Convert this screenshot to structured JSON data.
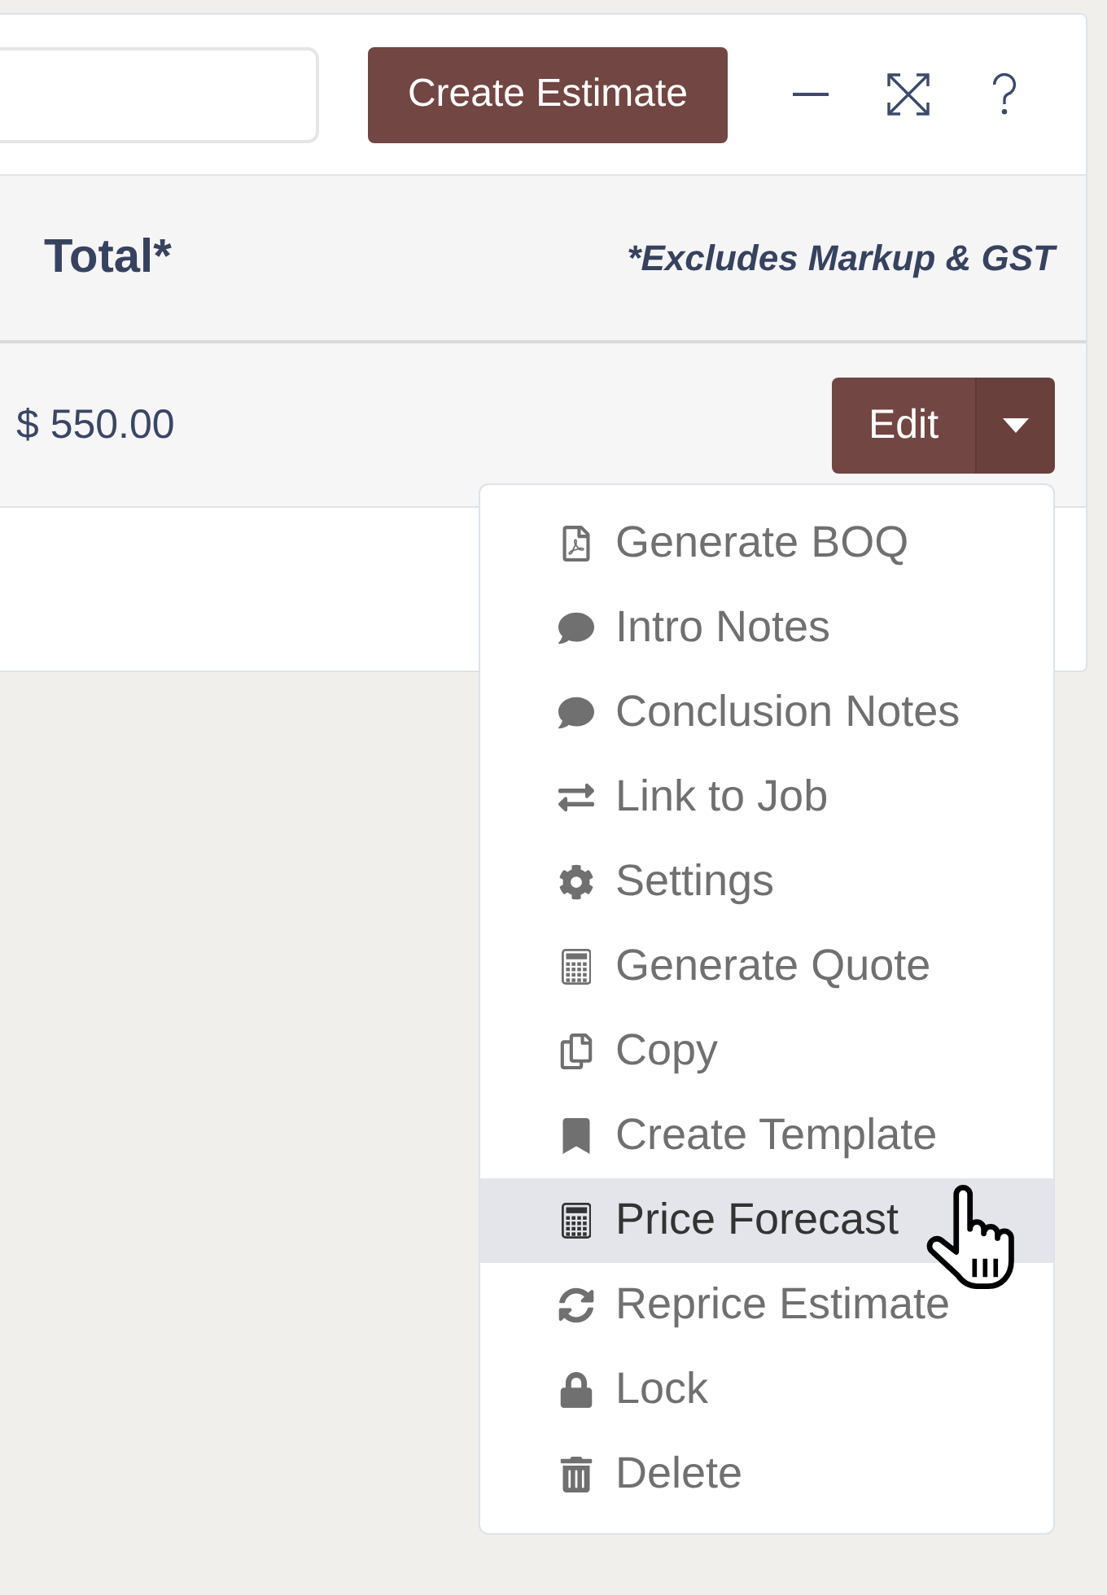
{
  "header": {
    "create_button": "Create Estimate"
  },
  "table": {
    "columns": [
      {
        "label": "Total*"
      }
    ],
    "note": "*Excludes Markup & GST",
    "rows": [
      {
        "total": "$ 550.00",
        "edit_button": "Edit",
        "menu_expanded": true,
        "menu": [
          {
            "label": "Generate BOQ",
            "highlighted": false
          },
          {
            "label": "Intro Notes",
            "highlighted": false
          },
          {
            "label": "Conclusion Notes",
            "highlighted": false
          },
          {
            "label": "Link to Job",
            "highlighted": false
          },
          {
            "label": "Settings",
            "highlighted": false
          },
          {
            "label": "Generate Quote",
            "highlighted": false
          },
          {
            "label": "Copy",
            "highlighted": false
          },
          {
            "label": "Create Template",
            "highlighted": false
          },
          {
            "label": "Price Forecast",
            "highlighted": true
          },
          {
            "label": "Reprice Estimate",
            "highlighted": false
          },
          {
            "label": "Lock",
            "highlighted": false
          },
          {
            "label": "Delete",
            "highlighted": false
          }
        ]
      }
    ]
  }
}
